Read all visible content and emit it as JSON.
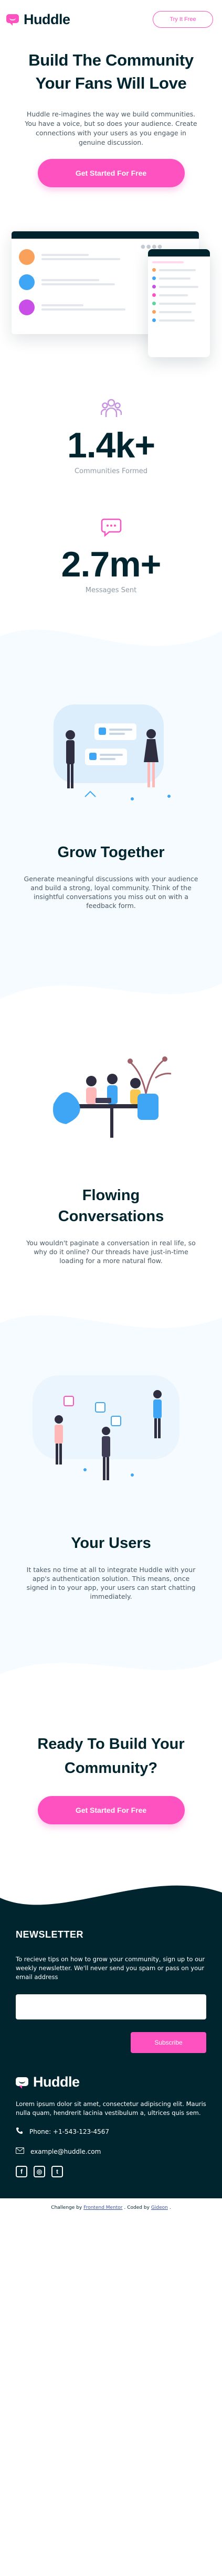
{
  "header": {
    "brand": "Huddle",
    "try_label": "Try It Free"
  },
  "hero": {
    "title": "Build The Community Your Fans Will Love",
    "text": "Huddle re-imagines the way we build communities. You have a voice, but so does your audience. Create connections with your users as you engage in genuine discussion.",
    "cta_label": "Get Started For Free"
  },
  "stats": [
    {
      "value": "1.4k+",
      "label": "Communities Formed",
      "icon": "communities-icon"
    },
    {
      "value": "2.7m+",
      "label": "Messages Sent",
      "icon": "messages-icon"
    }
  ],
  "features": [
    {
      "title": "Grow Together",
      "text": "Generate meaningful discussions with your audience and build a strong, loyal community. Think of the insightful conversations you miss out on with a feedback form.",
      "illustration": "grow-together-illustration"
    },
    {
      "title": "Flowing Conversations",
      "text": "You wouldn't paginate a conversation in real life, so why do it online? Our threads have just-in-time loading for a more natural flow.",
      "illustration": "flowing-conversations-illustration"
    },
    {
      "title": "Your Users",
      "text": "It takes no time at all to integrate Huddle with your app's authentication solution. This means, once signed in to your app, your users can start chatting immediately.",
      "illustration": "your-users-illustration"
    }
  ],
  "cta": {
    "title": "Ready To Build Your Community?",
    "button_label": "Get Started For Free"
  },
  "footer": {
    "newsletter_title": "NEWSLETTER",
    "newsletter_text": "To recieve tips on how to grow your community, sign up to our weekly newsletter. We'll never send you spam or pass on your email address",
    "email_value": "",
    "subscribe_label": "Subscribe",
    "brand": "Huddle",
    "about": "Lorem ipsum dolor sit amet, consectetur adipiscing elit. Mauris nulla quam, hendrerit lacinia vestibulum a, ultrices quis sem.",
    "phone": "Phone: +1-543-123-4567",
    "email": "example@huddle.com",
    "socials": [
      "facebook-icon",
      "instagram-icon",
      "twitter-icon"
    ]
  },
  "attribution": {
    "prefix": "Challenge by",
    "challenge_link": "Frontend Mentor",
    "middle": ". Coded by",
    "author_link": "Gideon",
    "suffix": "."
  },
  "colors": {
    "accent": "#ff52c1",
    "dark": "#00252e",
    "light_bg": "#f5fbff"
  }
}
